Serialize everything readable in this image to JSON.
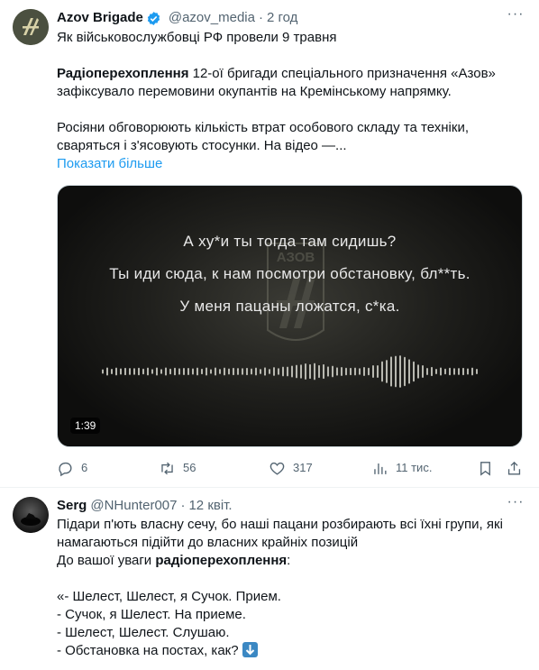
{
  "tweet1": {
    "author_name": "Azov Brigade",
    "handle": "@azov_media",
    "dot": "·",
    "time": "2 год",
    "lines": [
      "Як військовослужбовці РФ провели 9 травня"
    ],
    "para2_bold": "Радіоперехоплення",
    "para2_rest_line1": " 12-ої бригади спеціального призначення «Азов»",
    "para2_line2": "зафіксувало перемовини окупантів на Кремінському напрямку.",
    "para3_line1": "Росіяни обговорюють кількість втрат особового складу та техніки,",
    "para3_line2": "сваряться і з'ясовують стосунки. На відео —...",
    "show_more": "Показати більше",
    "video": {
      "caption1": "А ху*и ты тогда там сидишь?",
      "caption2": "Ты иди сюда, к нам посмотри обстановку, бл**ть.",
      "caption3": "У меня пацаны ложатся, с*ка.",
      "logo_text": "АЗОВ",
      "duration": "1:39"
    },
    "actions": {
      "replies": "6",
      "retweets": "56",
      "likes": "317",
      "views": "11 тис."
    }
  },
  "tweet2": {
    "author_name": "Serg",
    "handle": "@NHunter007",
    "dot": "·",
    "time": "12 квіт.",
    "line1": "Підари п'ють власну сечу, бо наші пацани розбирають всі їхні групи, які",
    "line2": "намагаються підійти до власних крайніх позицій",
    "line3_pre": "До вашої уваги ",
    "line3_bold": "радіоперехоплення",
    "line3_post": ":",
    "quote1": "«-  Шелест, Шелест, я Сучок. Прием.",
    "quote2": "-  Сучок, я Шелест. На приеме.",
    "quote3": "-  Шелест, Шелест. Слушаю.",
    "quote4": "- Обстановка на постах, как?"
  },
  "colors": {
    "link": "#1d9bf0",
    "verified": "#1d9bf0",
    "muted": "#536471"
  }
}
